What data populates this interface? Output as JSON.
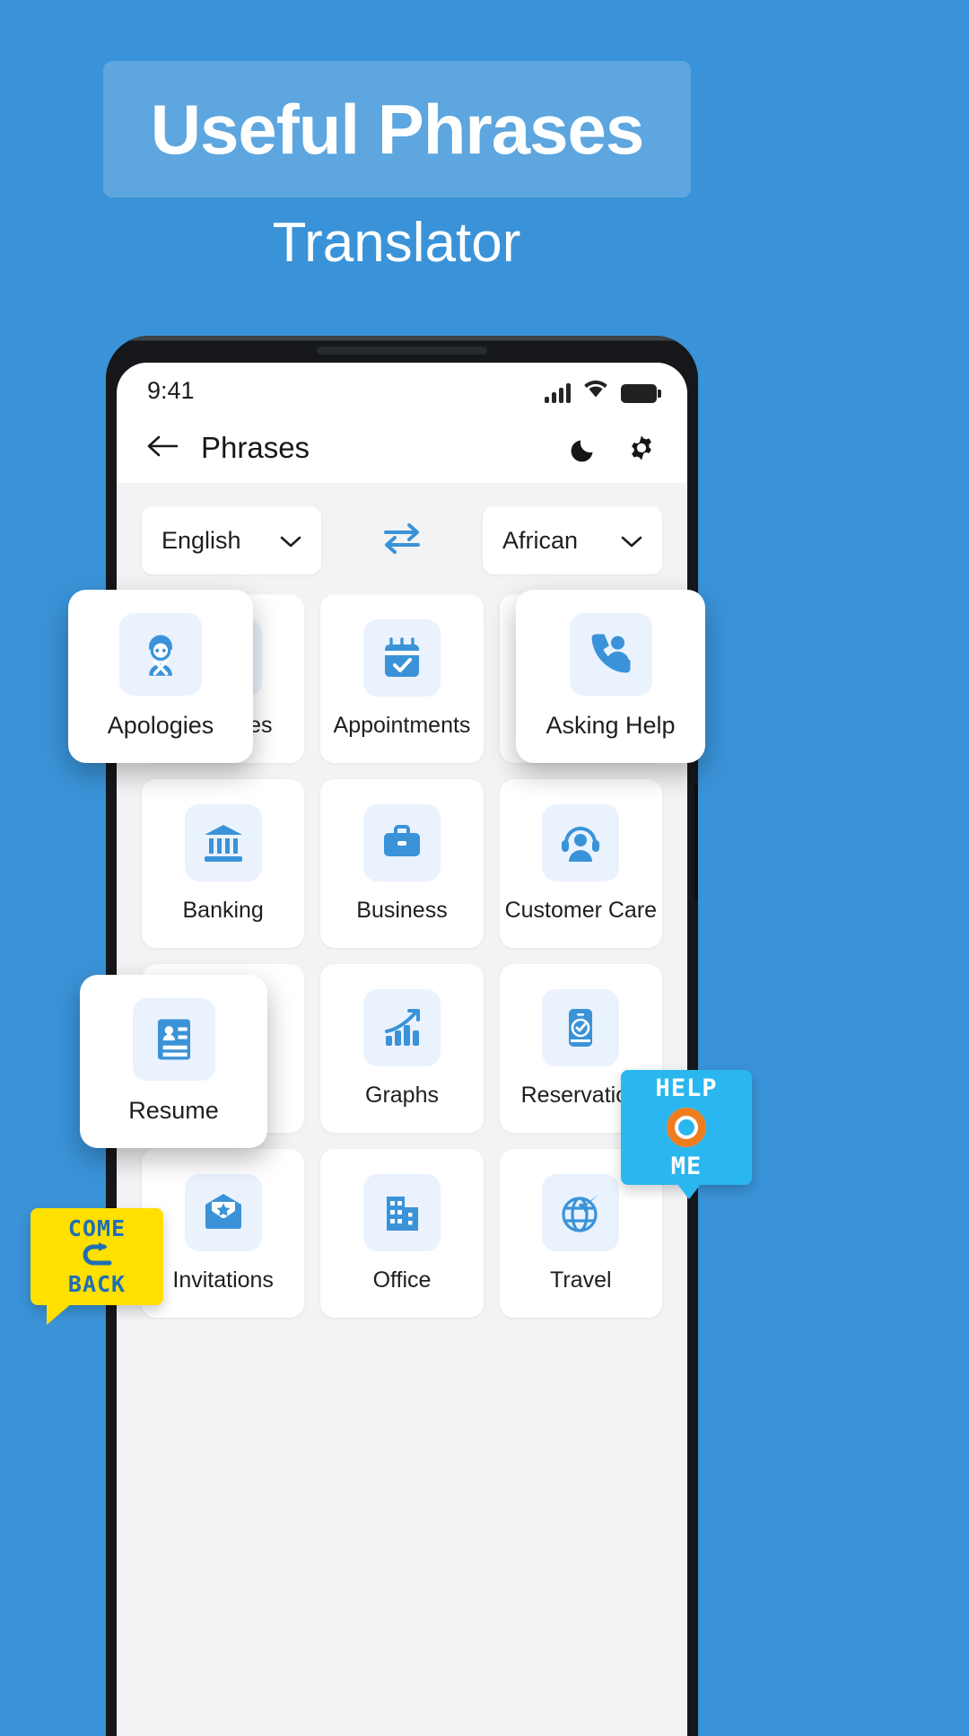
{
  "promo": {
    "title": "Useful Phrases",
    "subtitle": "Translator"
  },
  "phone": {
    "statusbar": {
      "time": "9:41",
      "signal_icon": "signal-bars-icon",
      "wifi_icon": "wifi-icon",
      "battery_icon": "battery-full-icon"
    },
    "appbar": {
      "back_icon": "back-arrow-icon",
      "title": "Phrases",
      "dark_mode_icon": "moon-icon",
      "settings_icon": "gear-icon"
    },
    "languages": {
      "source": "English",
      "target": "African",
      "source_chevron_icon": "chevron-down-icon",
      "target_chevron_icon": "chevron-down-icon",
      "swap_icon": "swap-arrows-icon"
    },
    "tiles": [
      {
        "label": "Apologies",
        "icon": "apology-person-icon",
        "popped": true
      },
      {
        "label": "Appointments",
        "icon": "calendar-check-icon",
        "popped": false
      },
      {
        "label": "Asking Help",
        "icon": "phone-support-icon",
        "popped": true
      },
      {
        "label": "Banking",
        "icon": "bank-building-icon",
        "popped": false
      },
      {
        "label": "Business",
        "icon": "briefcase-icon",
        "popped": false
      },
      {
        "label": "Customer Care",
        "icon": "headset-agent-icon",
        "popped": false
      },
      {
        "label": "Resume",
        "icon": "id-card-icon",
        "popped": true
      },
      {
        "label": "Graphs",
        "icon": "bar-chart-arrow-icon",
        "popped": false
      },
      {
        "label": "Reservation",
        "icon": "mobile-check-icon",
        "popped": false
      },
      {
        "label": "Invitations",
        "icon": "envelope-star-icon",
        "popped": false
      },
      {
        "label": "Office",
        "icon": "office-building-icon",
        "popped": false
      },
      {
        "label": "Travel",
        "icon": "globe-plane-icon",
        "popped": false
      }
    ]
  },
  "badges": {
    "help": {
      "line1": "HELP",
      "line2": "ME",
      "icon": "life-ring-icon",
      "color": "#2ab6ef"
    },
    "come_back": {
      "line1": "COME",
      "line2": "BACK",
      "icon": "u-turn-arrow-icon",
      "color": "#ffe000"
    }
  },
  "colors": {
    "background": "#3a93d8",
    "accent": "#3a93d8",
    "icon_blue": "#3a93d8",
    "icon_tile_bg": "#eaf2fe",
    "screen_bg": "#f2f3f5"
  }
}
